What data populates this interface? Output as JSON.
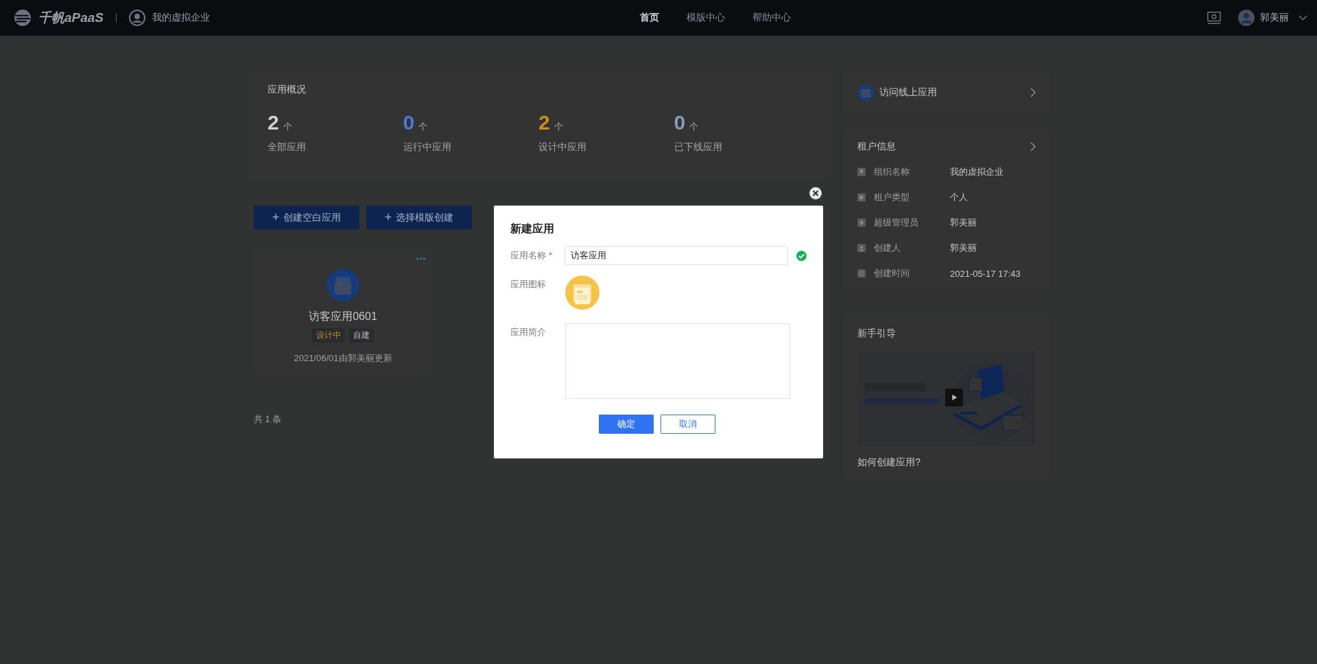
{
  "header": {
    "brand": "千帆aPaaS",
    "org": "我的虚拟企业",
    "nav": [
      {
        "label": "首页",
        "selected": true
      },
      {
        "label": "模版中心",
        "selected": false
      },
      {
        "label": "帮助中心",
        "selected": false
      }
    ],
    "user": "郭美丽"
  },
  "overview": {
    "title": "应用概况",
    "stats": [
      {
        "value": "2",
        "unit": "个",
        "label": "全部应用",
        "color": "#d0d0d0"
      },
      {
        "value": "0",
        "unit": "个",
        "label": "运行中应用",
        "color": "#4a7ad8"
      },
      {
        "value": "2",
        "unit": "个",
        "label": "设计中应用",
        "color": "#c8901e"
      },
      {
        "value": "0",
        "unit": "个",
        "label": "已下线应用",
        "color": "#8a9ab8"
      }
    ]
  },
  "actions": [
    {
      "icon": "+",
      "label": "创建空白应用"
    },
    {
      "icon": "+",
      "label": "选择模版创建"
    }
  ],
  "apps": [
    {
      "name": "访客应用0601",
      "tags": [
        {
          "label": "设计中",
          "color": "#c8901e"
        },
        {
          "label": "自建",
          "color": "#b8b8b8"
        }
      ],
      "updated": "2021/06/01由郭美丽更新"
    }
  ],
  "total": "共 1 条",
  "sidebar": {
    "visit": "访问线上应用",
    "tenant": {
      "title": "租户信息",
      "rows": [
        {
          "label": "组织名称",
          "value": "我的虚拟企业"
        },
        {
          "label": "租户类型",
          "value": "个人"
        },
        {
          "label": "超级管理员",
          "value": "郭美丽"
        },
        {
          "label": "创建人",
          "value": "郭美丽"
        },
        {
          "label": "创建时间",
          "value": "2021-05-17 17:43"
        }
      ]
    },
    "guide": {
      "title": "新手引导",
      "caption": "如何创建应用?"
    }
  },
  "dialog": {
    "title": "新建应用",
    "fields": [
      {
        "kind": "text",
        "label": "应用名称",
        "required_mark": "*",
        "value": "访客应用",
        "valid": true
      },
      {
        "kind": "icon",
        "label": "应用图标"
      },
      {
        "kind": "textarea",
        "label": "应用简介"
      }
    ],
    "buttons": [
      {
        "label": "确定",
        "primary": true
      },
      {
        "label": "取消",
        "primary": false
      }
    ]
  }
}
